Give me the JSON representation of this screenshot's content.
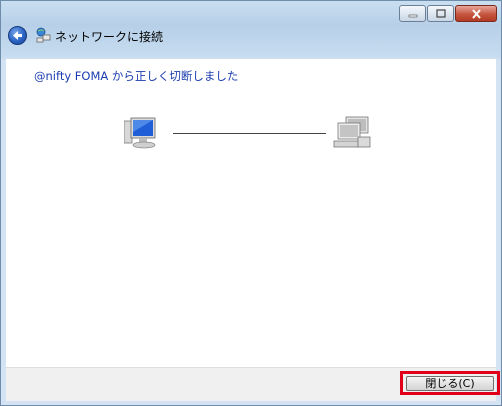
{
  "window": {
    "title": "ネットワークに接続",
    "controls": {
      "minimize": "minimize-icon",
      "maximize": "maximize-icon",
      "close": "close-icon"
    }
  },
  "content": {
    "message": "@nifty FOMA から正しく切断しました",
    "icons": {
      "local": "computer-icon",
      "remote": "network-server-icon"
    }
  },
  "footer": {
    "close_label": "閉じる(C)"
  },
  "colors": {
    "message": "#1a3cb0",
    "highlight": "#e0001a"
  }
}
